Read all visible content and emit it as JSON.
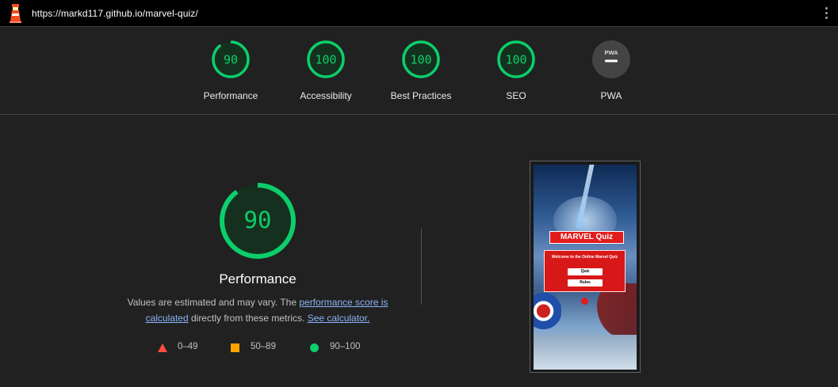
{
  "browser": {
    "url": "https://markd117.github.io/marvel-quiz/"
  },
  "categories": [
    {
      "label": "Performance",
      "score": "90",
      "fraction": 0.9
    },
    {
      "label": "Accessibility",
      "score": "100",
      "fraction": 1.0
    },
    {
      "label": "Best Practices",
      "score": "100",
      "fraction": 1.0
    },
    {
      "label": "SEO",
      "score": "100",
      "fraction": 1.0
    },
    {
      "label": "PWA",
      "badge": "PWA"
    }
  ],
  "main": {
    "score": "90",
    "fraction": 0.9,
    "title": "Performance",
    "desc_prefix": "Values are estimated and may vary. The ",
    "desc_link1": "performance score is calculated",
    "desc_middle": " directly from these metrics. ",
    "desc_link2": "See calculator."
  },
  "legend": [
    {
      "range": "0–49",
      "color": "#ff4e42",
      "shape": "triangle"
    },
    {
      "range": "50–89",
      "color": "#ffa400",
      "shape": "square"
    },
    {
      "range": "90–100",
      "color": "#0cce6b",
      "shape": "circle"
    }
  ],
  "screenshot": {
    "title": "MARVEL Quiz",
    "welcome": "Welcome to the Online Marvel Quiz",
    "btn_quiz": "Quiz",
    "btn_rules": "Rules"
  },
  "colors": {
    "pass": "#0cce6b",
    "pass_bg": "#16301f",
    "background": "#212121"
  }
}
